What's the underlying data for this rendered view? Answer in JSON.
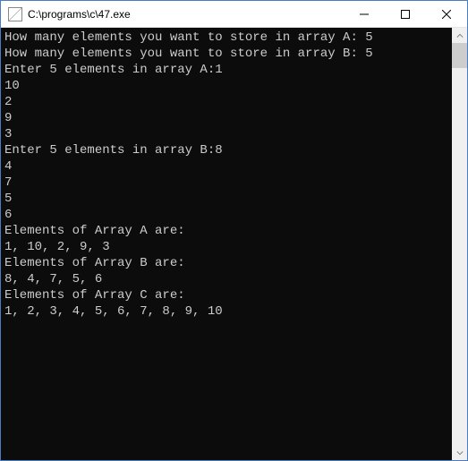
{
  "titlebar": {
    "title": "C:\\programs\\c\\47.exe"
  },
  "console": {
    "lines": [
      "How many elements you want to store in array A: 5",
      "How many elements you want to store in array B: 5",
      "Enter 5 elements in array A:1",
      "10",
      "2",
      "9",
      "3",
      "Enter 5 elements in array B:8",
      "4",
      "7",
      "5",
      "6",
      "",
      "Elements of Array A are:",
      "1, 10, 2, 9, 3",
      "",
      "Elements of Array B are:",
      "8, 4, 7, 5, 6",
      "",
      "Elements of Array C are:",
      "1, 2, 3, 4, 5, 6, 7, 8, 9, 10"
    ]
  }
}
